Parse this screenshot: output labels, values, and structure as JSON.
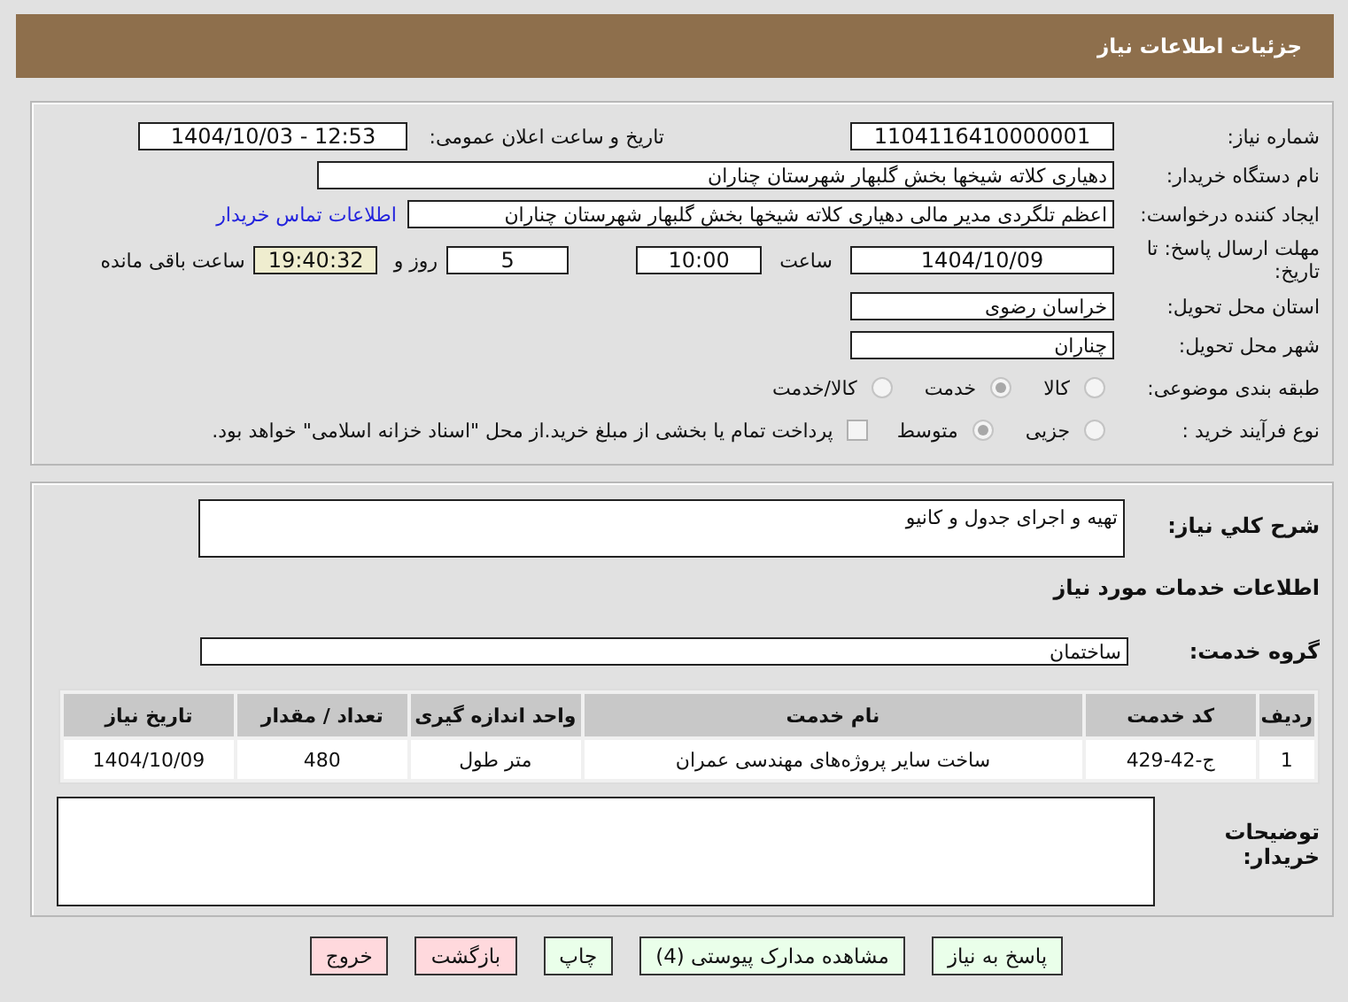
{
  "header": {
    "title": "جزئیات اطلاعات نیاز"
  },
  "details": {
    "need_number": {
      "label": "شماره نیاز:",
      "value": "1104116410000001"
    },
    "announce": {
      "label": "تاریخ و ساعت اعلان عمومی:",
      "value": "1404/10/03 - 12:53"
    },
    "buyer": {
      "label": "نام دستگاه خریدار:",
      "value": "دهیاری کلاته شیخها بخش گلبهار شهرستان چناران"
    },
    "creator": {
      "label": "ایجاد کننده درخواست:",
      "value": "اعظم تلگردی مدیر مالی دهیاری کلاته شیخها بخش گلبهار شهرستان چناران",
      "link": "اطلاعات تماس خریدار"
    },
    "deadline": {
      "label": "مهلت ارسال پاسخ: تا تاریخ:",
      "date": "1404/10/09",
      "time_label": "ساعت",
      "time": "10:00",
      "days": "5",
      "days_label": "روز و",
      "remaining": "19:40:32",
      "remaining_label": "ساعت باقی مانده"
    },
    "province": {
      "label": "استان محل تحویل:",
      "value": "خراسان رضوی"
    },
    "city": {
      "label": "شهر محل تحویل:",
      "value": "چناران"
    },
    "category": {
      "label": "طبقه بندی موضوعی:",
      "options": [
        {
          "label": "کالا",
          "selected": false
        },
        {
          "label": "خدمت",
          "selected": true
        },
        {
          "label": "کالا/خدمت",
          "selected": false
        }
      ]
    },
    "purchase_type": {
      "label": "نوع فرآیند خرید :",
      "options": [
        {
          "label": "جزیی",
          "selected": false
        },
        {
          "label": "متوسط",
          "selected": true
        }
      ],
      "payment": {
        "checked": false,
        "text": "پرداخت تمام یا بخشی از مبلغ خرید.از محل \"اسناد خزانه اسلامی\" خواهد بود."
      }
    }
  },
  "description": {
    "label": "شرح کلي نیاز:",
    "value": "تهیه و اجرای جدول و کانیو"
  },
  "services": {
    "title": "اطلاعات خدمات مورد نیاز",
    "group_label": "گروه خدمت:",
    "group": "ساختمان",
    "table": {
      "columns": [
        "ردیف",
        "کد خدمت",
        "نام خدمت",
        "واحد اندازه گیری",
        "تعداد / مقدار",
        "تاریخ نیاز"
      ],
      "rows": [
        [
          "1",
          "ج-42-429",
          "ساخت سایر پروژه‌های مهندسی عمران",
          "متر طول",
          "480",
          "1404/10/09"
        ]
      ]
    }
  },
  "buyer_notes": {
    "label": "توضیحات خریدار:"
  },
  "buttons": [
    {
      "label": "پاسخ به نیاز",
      "kind": "primary"
    },
    {
      "label": "مشاهده مدارک پیوستی (4)",
      "kind": "primary"
    },
    {
      "label": "چاپ",
      "kind": "primary"
    },
    {
      "label": "بازگشت",
      "kind": "danger"
    },
    {
      "label": "خروج",
      "kind": "danger"
    }
  ]
}
